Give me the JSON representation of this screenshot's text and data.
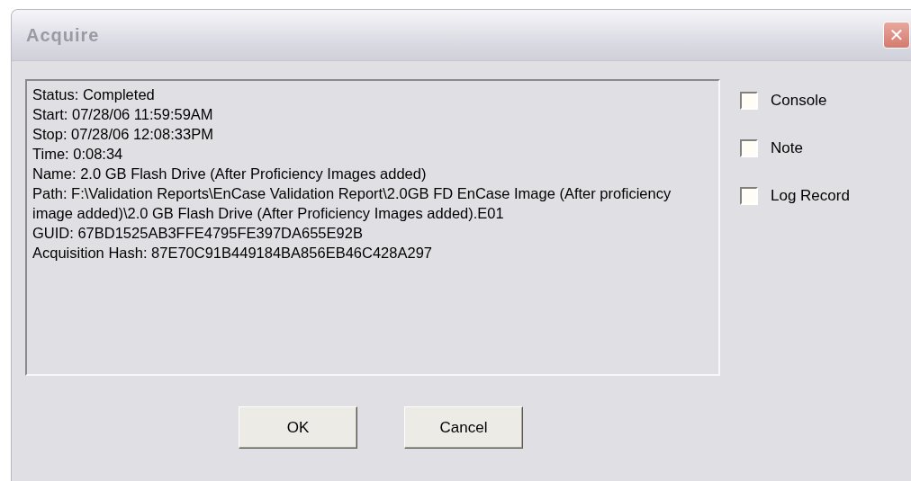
{
  "window": {
    "title": "Acquire",
    "close_label": "✕"
  },
  "report_lines": [
    "Status: Completed",
    "Start: 07/28/06 11:59:59AM",
    "Stop: 07/28/06 12:08:33PM",
    "Time: 0:08:34",
    "Name: 2.0 GB Flash Drive (After Proficiency Images added)",
    "Path: F:\\Validation Reports\\EnCase Validation Report\\2.0GB FD EnCase Image (After proficiency image added)\\2.0 GB Flash Drive (After Proficiency Images added).E01",
    "GUID: 67BD1525AB3FFE4795FE397DA655E92B",
    "Acquisition Hash: 87E70C91B449184BA856EB46C428A297"
  ],
  "options": [
    {
      "label": "Console",
      "checked": false
    },
    {
      "label": "Note",
      "checked": false
    },
    {
      "label": "Log Record",
      "checked": false
    }
  ],
  "buttons": [
    "OK",
    "Cancel"
  ]
}
